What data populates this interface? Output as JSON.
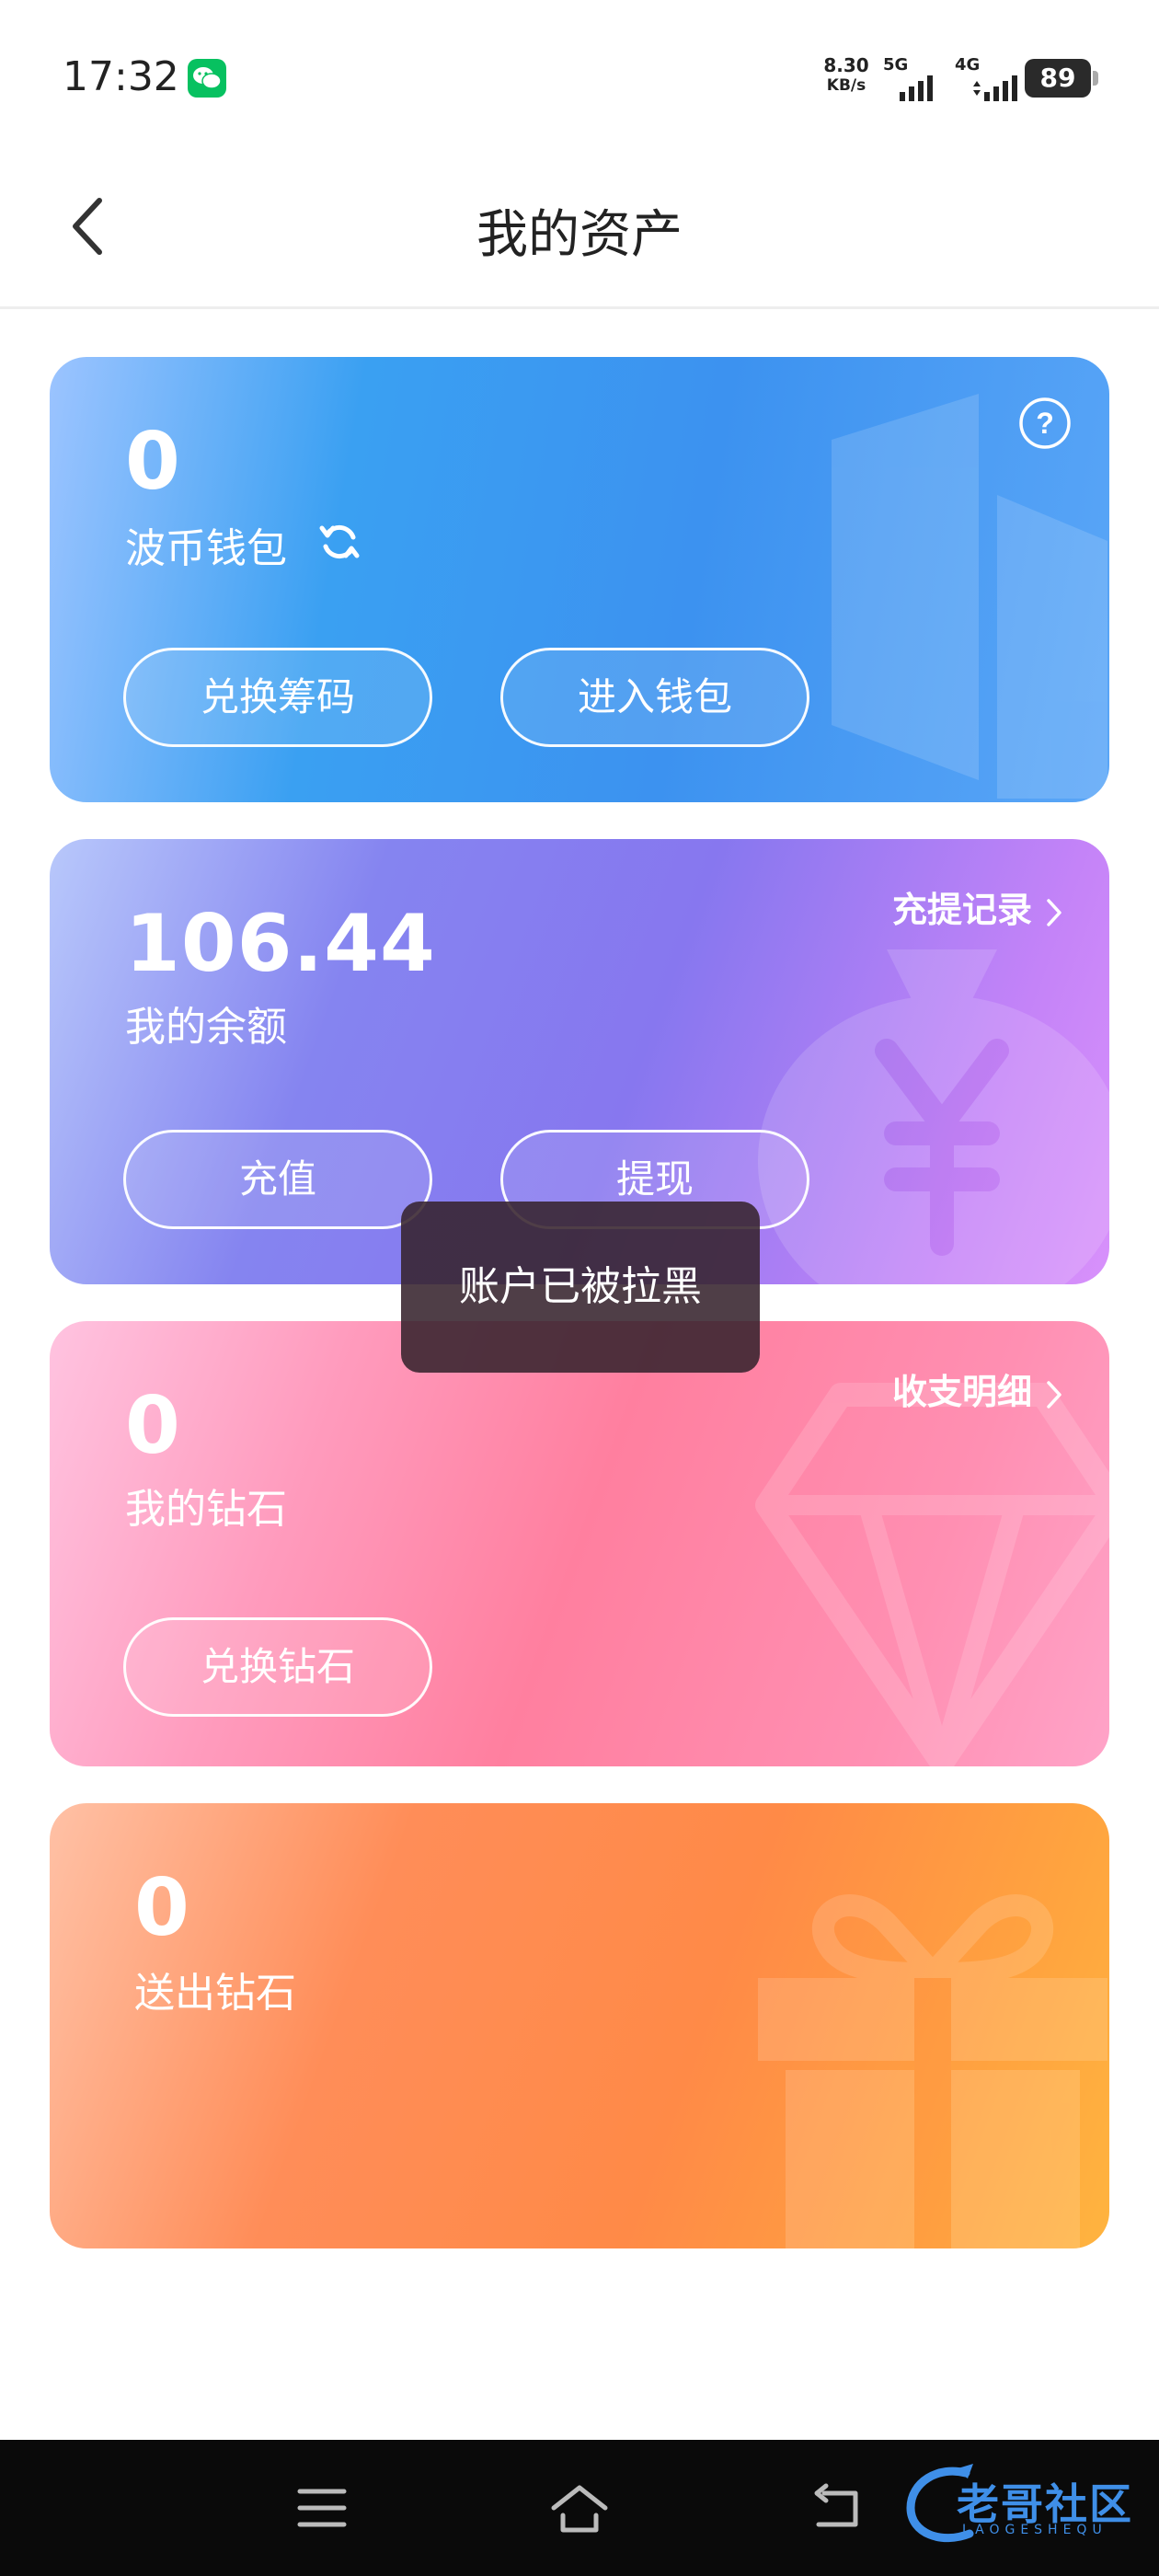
{
  "status_bar": {
    "time": "17:32",
    "net_speed_value": "8.30",
    "net_speed_unit": "KB/s",
    "sim1_label": "5G",
    "sim2_label": "4G",
    "battery": "89"
  },
  "nav": {
    "title": "我的资产"
  },
  "cards": {
    "wallet": {
      "value": "0",
      "label": "波币钱包",
      "btn_exchange": "兑换筹码",
      "btn_enter": "进入钱包"
    },
    "balance": {
      "value": "106.44",
      "label": "我的余额",
      "link": "充提记录",
      "btn_recharge": "充值",
      "btn_withdraw": "提现"
    },
    "diamond": {
      "value": "0",
      "label": "我的钻石",
      "link": "收支明细",
      "btn_exchange": "兑换钻石"
    },
    "sent": {
      "value": "0",
      "label": "送出钻石"
    }
  },
  "toast": {
    "message": "账户已被拉黑"
  },
  "watermark": {
    "text": "老哥社区",
    "sub": "LAOGESHEQU"
  },
  "colors": {
    "wallet_accent": "#3c92f0",
    "balance_accent": "#8777ef",
    "diamond_accent": "#ff7f9f",
    "sent_accent": "#ff8a47",
    "wechat_green": "#07c160"
  }
}
